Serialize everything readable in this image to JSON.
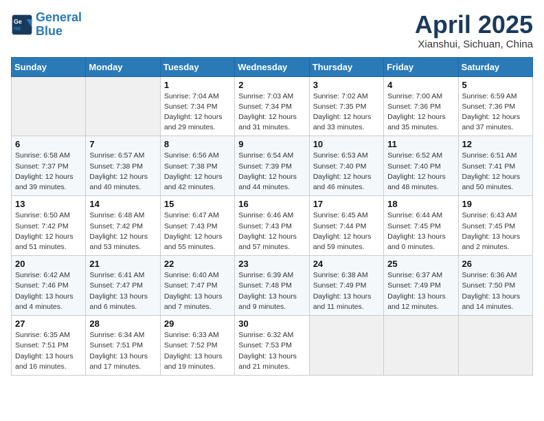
{
  "header": {
    "logo_line1": "General",
    "logo_line2": "Blue",
    "title": "April 2025",
    "subtitle": "Xianshui, Sichuan, China"
  },
  "days_of_week": [
    "Sunday",
    "Monday",
    "Tuesday",
    "Wednesday",
    "Thursday",
    "Friday",
    "Saturday"
  ],
  "weeks": [
    [
      {
        "day": "",
        "info": ""
      },
      {
        "day": "",
        "info": ""
      },
      {
        "day": "1",
        "info": "Sunrise: 7:04 AM\nSunset: 7:34 PM\nDaylight: 12 hours and 29 minutes."
      },
      {
        "day": "2",
        "info": "Sunrise: 7:03 AM\nSunset: 7:34 PM\nDaylight: 12 hours and 31 minutes."
      },
      {
        "day": "3",
        "info": "Sunrise: 7:02 AM\nSunset: 7:35 PM\nDaylight: 12 hours and 33 minutes."
      },
      {
        "day": "4",
        "info": "Sunrise: 7:00 AM\nSunset: 7:36 PM\nDaylight: 12 hours and 35 minutes."
      },
      {
        "day": "5",
        "info": "Sunrise: 6:59 AM\nSunset: 7:36 PM\nDaylight: 12 hours and 37 minutes."
      }
    ],
    [
      {
        "day": "6",
        "info": "Sunrise: 6:58 AM\nSunset: 7:37 PM\nDaylight: 12 hours and 39 minutes."
      },
      {
        "day": "7",
        "info": "Sunrise: 6:57 AM\nSunset: 7:38 PM\nDaylight: 12 hours and 40 minutes."
      },
      {
        "day": "8",
        "info": "Sunrise: 6:56 AM\nSunset: 7:38 PM\nDaylight: 12 hours and 42 minutes."
      },
      {
        "day": "9",
        "info": "Sunrise: 6:54 AM\nSunset: 7:39 PM\nDaylight: 12 hours and 44 minutes."
      },
      {
        "day": "10",
        "info": "Sunrise: 6:53 AM\nSunset: 7:40 PM\nDaylight: 12 hours and 46 minutes."
      },
      {
        "day": "11",
        "info": "Sunrise: 6:52 AM\nSunset: 7:40 PM\nDaylight: 12 hours and 48 minutes."
      },
      {
        "day": "12",
        "info": "Sunrise: 6:51 AM\nSunset: 7:41 PM\nDaylight: 12 hours and 50 minutes."
      }
    ],
    [
      {
        "day": "13",
        "info": "Sunrise: 6:50 AM\nSunset: 7:42 PM\nDaylight: 12 hours and 51 minutes."
      },
      {
        "day": "14",
        "info": "Sunrise: 6:48 AM\nSunset: 7:42 PM\nDaylight: 12 hours and 53 minutes."
      },
      {
        "day": "15",
        "info": "Sunrise: 6:47 AM\nSunset: 7:43 PM\nDaylight: 12 hours and 55 minutes."
      },
      {
        "day": "16",
        "info": "Sunrise: 6:46 AM\nSunset: 7:43 PM\nDaylight: 12 hours and 57 minutes."
      },
      {
        "day": "17",
        "info": "Sunrise: 6:45 AM\nSunset: 7:44 PM\nDaylight: 12 hours and 59 minutes."
      },
      {
        "day": "18",
        "info": "Sunrise: 6:44 AM\nSunset: 7:45 PM\nDaylight: 13 hours and 0 minutes."
      },
      {
        "day": "19",
        "info": "Sunrise: 6:43 AM\nSunset: 7:45 PM\nDaylight: 13 hours and 2 minutes."
      }
    ],
    [
      {
        "day": "20",
        "info": "Sunrise: 6:42 AM\nSunset: 7:46 PM\nDaylight: 13 hours and 4 minutes."
      },
      {
        "day": "21",
        "info": "Sunrise: 6:41 AM\nSunset: 7:47 PM\nDaylight: 13 hours and 6 minutes."
      },
      {
        "day": "22",
        "info": "Sunrise: 6:40 AM\nSunset: 7:47 PM\nDaylight: 13 hours and 7 minutes."
      },
      {
        "day": "23",
        "info": "Sunrise: 6:39 AM\nSunset: 7:48 PM\nDaylight: 13 hours and 9 minutes."
      },
      {
        "day": "24",
        "info": "Sunrise: 6:38 AM\nSunset: 7:49 PM\nDaylight: 13 hours and 11 minutes."
      },
      {
        "day": "25",
        "info": "Sunrise: 6:37 AM\nSunset: 7:49 PM\nDaylight: 13 hours and 12 minutes."
      },
      {
        "day": "26",
        "info": "Sunrise: 6:36 AM\nSunset: 7:50 PM\nDaylight: 13 hours and 14 minutes."
      }
    ],
    [
      {
        "day": "27",
        "info": "Sunrise: 6:35 AM\nSunset: 7:51 PM\nDaylight: 13 hours and 16 minutes."
      },
      {
        "day": "28",
        "info": "Sunrise: 6:34 AM\nSunset: 7:51 PM\nDaylight: 13 hours and 17 minutes."
      },
      {
        "day": "29",
        "info": "Sunrise: 6:33 AM\nSunset: 7:52 PM\nDaylight: 13 hours and 19 minutes."
      },
      {
        "day": "30",
        "info": "Sunrise: 6:32 AM\nSunset: 7:53 PM\nDaylight: 13 hours and 21 minutes."
      },
      {
        "day": "",
        "info": ""
      },
      {
        "day": "",
        "info": ""
      },
      {
        "day": "",
        "info": ""
      }
    ]
  ]
}
